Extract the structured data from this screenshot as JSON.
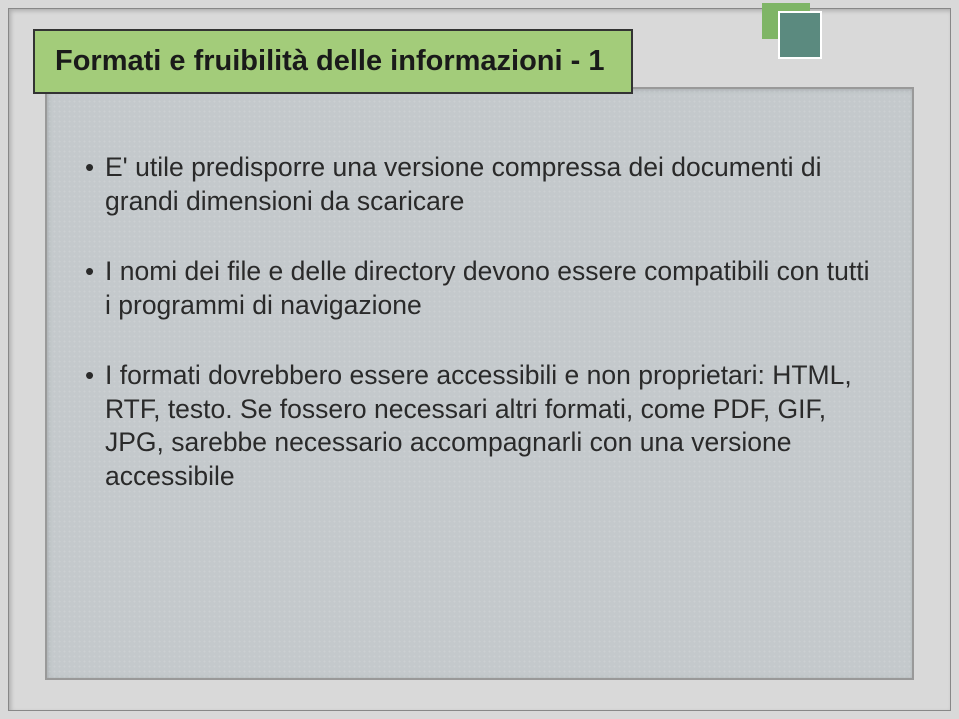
{
  "title": "Formati e fruibilità delle informazioni - 1",
  "bullets": [
    "E' utile predisporre una versione compressa dei documenti di grandi dimensioni da scaricare",
    "I nomi dei file e delle directory devono essere compatibili con tutti i programmi di navigazione",
    "I formati dovrebbero essere accessibili e non proprietari: HTML, RTF, testo. Se fossero necessari altri formati, come PDF, GIF, JPG, sarebbe necessario accompagnarli con una versione accessibile"
  ]
}
